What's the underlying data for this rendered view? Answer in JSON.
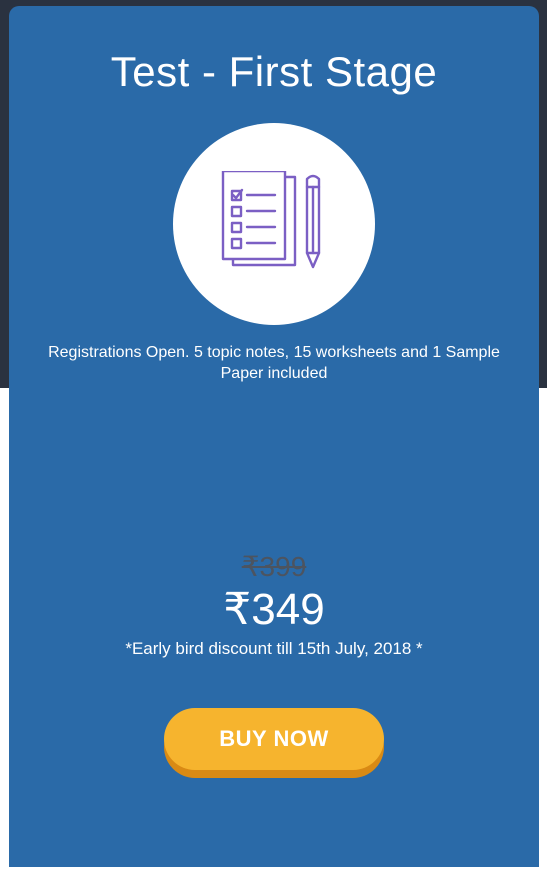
{
  "card": {
    "title": "Test - First Stage",
    "icon": "test-paper-with-pencil-icon",
    "description": "Registrations Open. 5 topic notes, 15 worksheets and 1 Sample Paper included",
    "old_price": "₹399",
    "new_price": "₹349",
    "discount_note": "*Early bird discount till 15th July, 2018 *",
    "buy_label": "BUY NOW"
  },
  "colors": {
    "page_top_band": "#2a3240",
    "card_background": "#2a6aa8",
    "button_background": "#f6b42e",
    "button_shadow": "#d98a14",
    "icon_stroke": "#7b5fc4",
    "old_price_text": "#4c5460"
  }
}
